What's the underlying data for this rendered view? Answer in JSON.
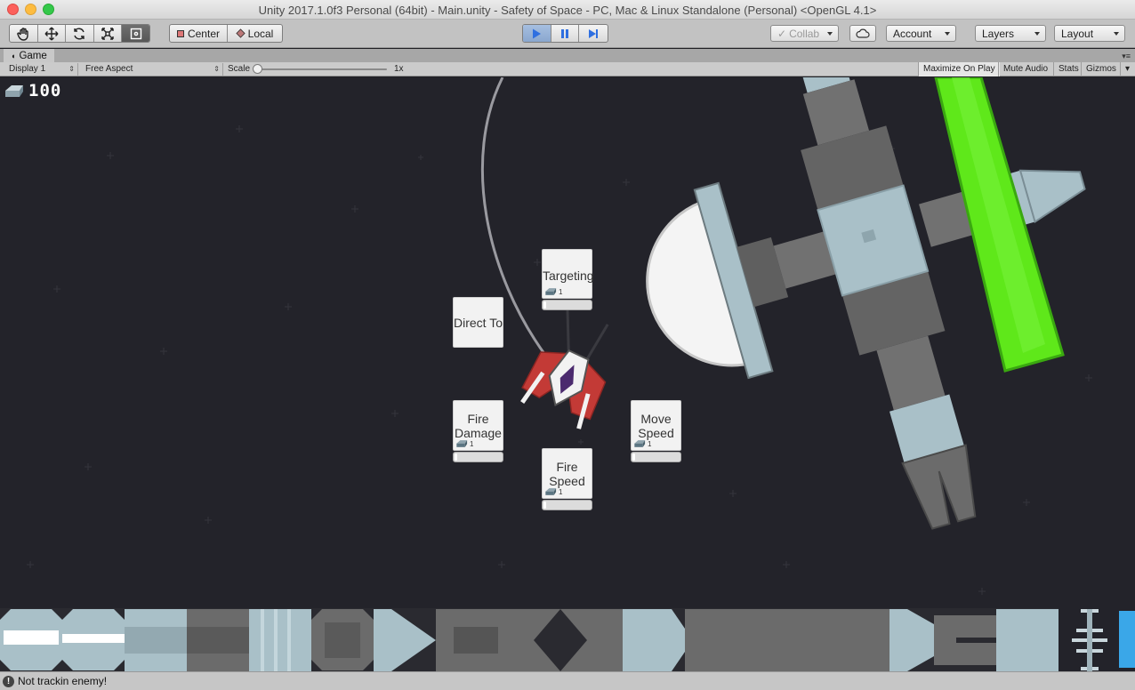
{
  "window": {
    "title": "Unity 2017.1.0f3 Personal (64bit) - Main.unity - Safety of Space - PC, Mac & Linux Standalone (Personal) <OpenGL 4.1>"
  },
  "toolbar": {
    "tools": [
      {
        "name": "hand-tool",
        "icon": "hand-icon"
      },
      {
        "name": "move-tool",
        "icon": "move-arrows-icon"
      },
      {
        "name": "rotate-tool",
        "icon": "rotate-icon"
      },
      {
        "name": "scale-tool",
        "icon": "scale-icon"
      },
      {
        "name": "rect-tool",
        "icon": "rect-transform-icon"
      }
    ],
    "pivot_label": "Center",
    "space_label": "Local",
    "collab_label": "Collab",
    "account_label": "Account",
    "layers_label": "Layers",
    "layout_label": "Layout"
  },
  "game_tab": {
    "label": "Game",
    "display": "Display 1",
    "aspect": "Free Aspect",
    "scale_label": "Scale",
    "scale_value": "1x",
    "maximize_on_play": "Maximize On Play",
    "mute_audio": "Mute Audio",
    "stats": "Stats",
    "gizmos": "Gizmos"
  },
  "hud": {
    "resource_count": "100",
    "resource_icon": "metal-ingot-icon"
  },
  "upgrades": [
    {
      "id": "targeting",
      "label": "Targeting",
      "cost": "1",
      "progress": 0
    },
    {
      "id": "direct-to",
      "label": "Direct To"
    },
    {
      "id": "fire-damage",
      "label": "Fire\nDamage",
      "cost": "1",
      "progress": 0
    },
    {
      "id": "move-speed",
      "label": "Move\nSpeed",
      "cost": "1",
      "progress": 0
    },
    {
      "id": "fire-speed",
      "label": "Fire\nSpeed",
      "cost": "1",
      "progress": 0
    }
  ],
  "colors": {
    "space": "#23232a",
    "energy_bar": "#5fe81a",
    "ship_red": "#c33a36",
    "station_gray": "#6b6b6b",
    "station_light": "#a9c0c8",
    "play_active": "#2f6fe0"
  },
  "status": {
    "message": "Not trackin enemy!"
  }
}
